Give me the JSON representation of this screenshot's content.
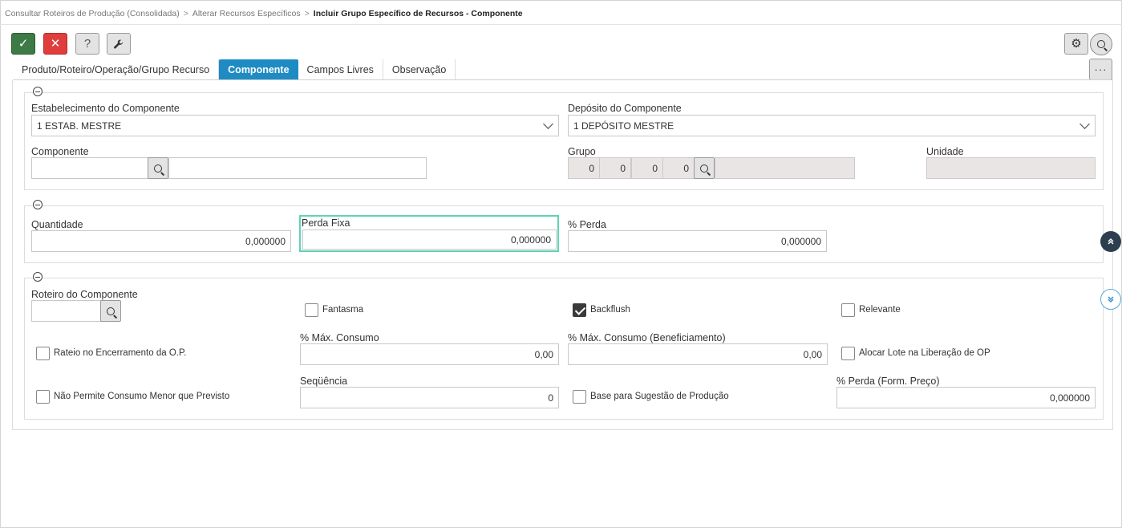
{
  "breadcrumb": {
    "items": [
      "Consultar Roteiros de Produção (Consolidada)",
      "Alterar Recursos Específicos"
    ],
    "current": "Incluir Grupo Específico de Recursos - Componente",
    "separator": ">"
  },
  "toolbar": {
    "ok_glyph": "✓",
    "cancel_glyph": "✕",
    "help_glyph": "?",
    "tool_glyph": "🔧",
    "gear_glyph": "⚙",
    "more_glyph": "···"
  },
  "tabs": [
    {
      "label": "Produto/Roteiro/Operação/Grupo Recurso",
      "active": false
    },
    {
      "label": "Componente",
      "active": true
    },
    {
      "label": "Campos Livres",
      "active": false
    },
    {
      "label": "Observação",
      "active": false
    }
  ],
  "section1": {
    "estabelecimento": {
      "label": "Estabelecimento do Componente",
      "value": "1 ESTAB. MESTRE"
    },
    "deposito": {
      "label": "Depósito do Componente",
      "value": "1 DEPÓSITO MESTRE"
    },
    "componente": {
      "label": "Componente",
      "code": "",
      "description": ""
    },
    "grupo": {
      "label": "Grupo",
      "values": [
        "0",
        "0",
        "0",
        "0"
      ],
      "description": ""
    },
    "unidade": {
      "label": "Unidade",
      "value": ""
    }
  },
  "section2": {
    "quantidade": {
      "label": "Quantidade",
      "value": "0,000000"
    },
    "perda_fixa": {
      "label": "Perda Fixa",
      "value": "0,000000"
    },
    "perc_perda": {
      "label": "% Perda",
      "value": "0,000000"
    }
  },
  "section3": {
    "roteiro": {
      "label": "Roteiro do Componente",
      "value": ""
    },
    "fantasma": {
      "label": "Fantasma",
      "checked": false
    },
    "backflush": {
      "label": "Backflush",
      "checked": true
    },
    "relevante": {
      "label": "Relevante",
      "checked": false
    },
    "rateio": {
      "label": "Rateio no Encerramento da O.P.",
      "checked": false
    },
    "max_consumo": {
      "label": "% Máx. Consumo",
      "value": "0,00"
    },
    "max_consumo_benef": {
      "label": "% Máx. Consumo (Beneficiamento)",
      "value": "0,00"
    },
    "alocar_lote": {
      "label": "Alocar Lote na Liberação de OP",
      "checked": false
    },
    "nao_permite": {
      "label": "Não Permite Consumo Menor que Previsto",
      "checked": false
    },
    "sequencia": {
      "label": "Seqüência",
      "value": "0"
    },
    "base_sugestao": {
      "label": "Base para Sugestão de Produção",
      "checked": false
    },
    "perda_form_preco": {
      "label": "% Perda (Form. Preço)",
      "value": "0,000000"
    }
  },
  "fab": {
    "up_glyph": "⌃",
    "down_glyph": "⌄"
  },
  "colors": {
    "accent": "#1e8bc3",
    "ok": "#3d7a45",
    "cancel": "#e03d3d",
    "focus": "#5fd3b4"
  }
}
